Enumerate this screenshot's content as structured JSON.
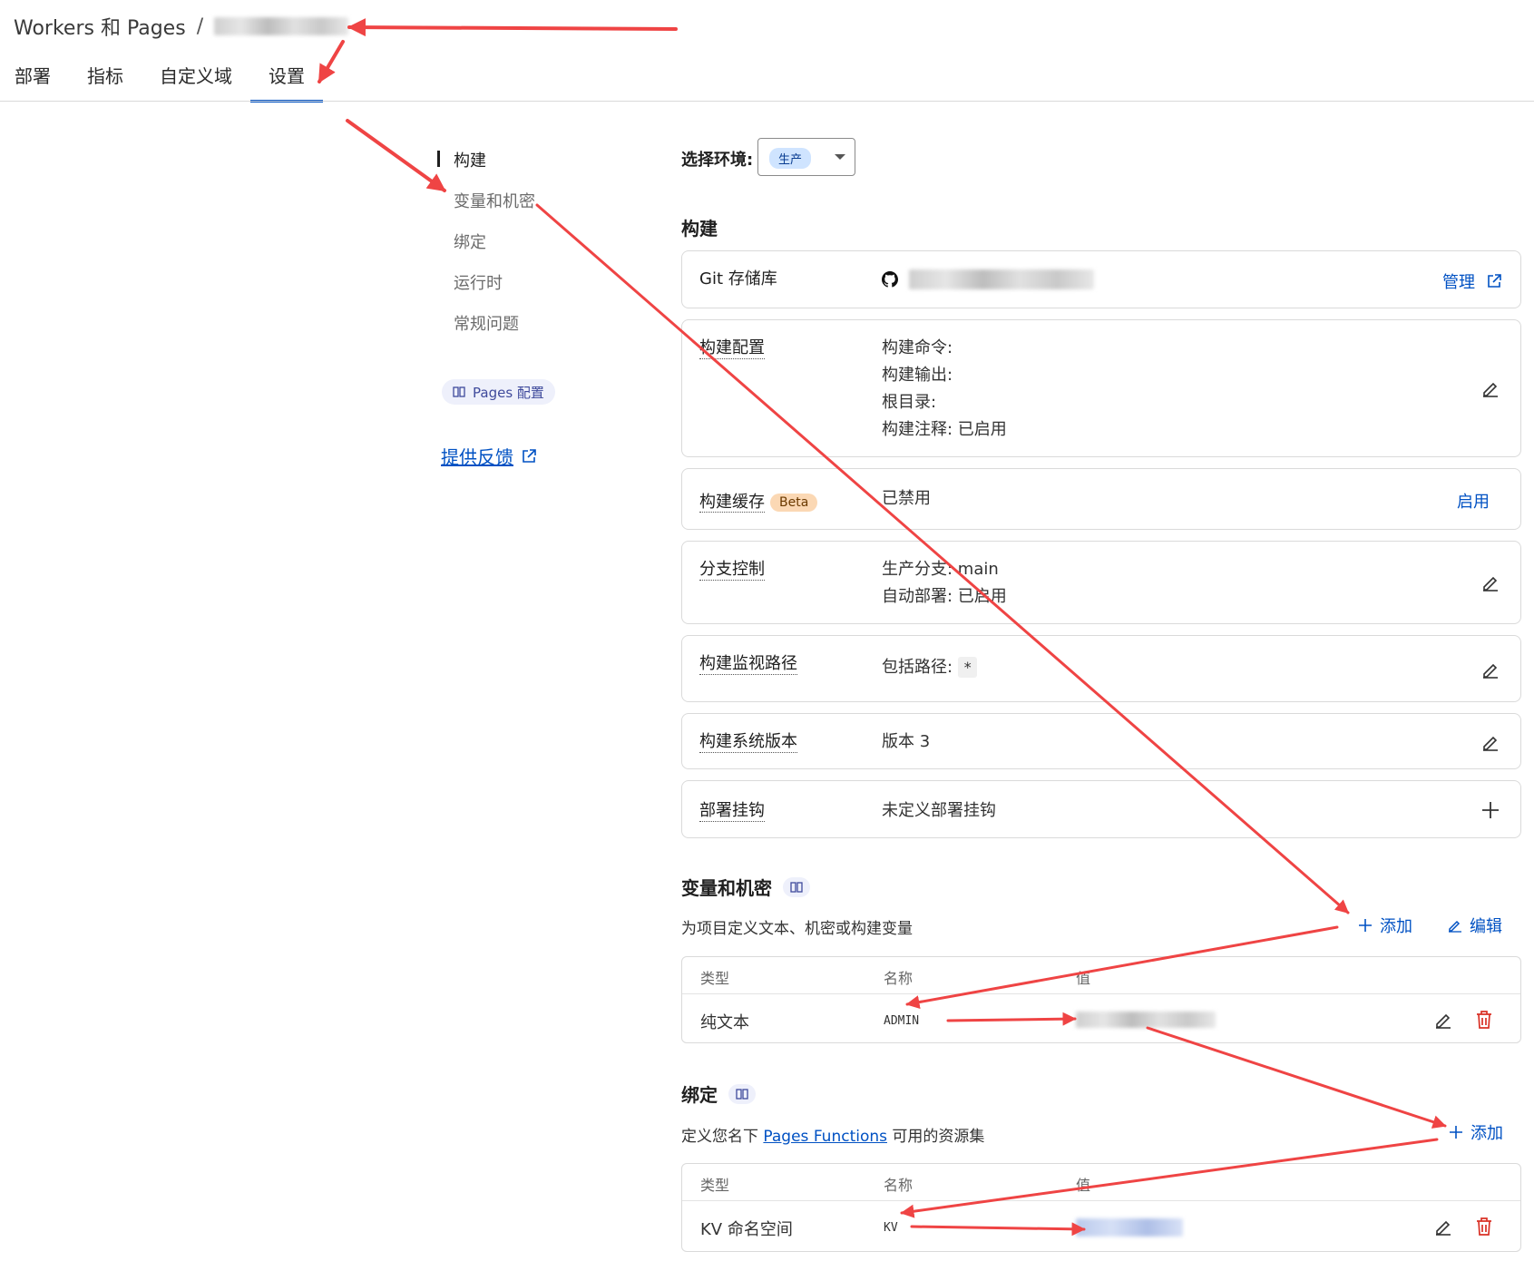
{
  "header": {
    "breadcrumb_root": "Workers 和 Pages",
    "breadcrumb_sep": "/",
    "tabs": [
      "部署",
      "指标",
      "自定义域",
      "设置"
    ],
    "active_tab": "设置"
  },
  "left_nav": {
    "items": [
      "构建",
      "变量和机密",
      "绑定",
      "运行时",
      "常规问题"
    ],
    "active": "构建",
    "pages_config": "Pages 配置",
    "feedback": "提供反馈"
  },
  "env": {
    "label": "选择环境:",
    "value": "生产"
  },
  "build": {
    "title": "构建",
    "git": {
      "label": "Git 存储库",
      "action": "管理"
    },
    "config": {
      "label": "构建配置",
      "lines": [
        "构建命令:",
        "构建输出:",
        "根目录:",
        "构建注释: 已启用"
      ]
    },
    "cache": {
      "label": "构建缓存",
      "badge": "Beta",
      "value": "已禁用",
      "action": "启用"
    },
    "branch": {
      "label": "分支控制",
      "lines": [
        "生产分支: main",
        "自动部署: 已启用"
      ]
    },
    "watch": {
      "label": "构建监视路径",
      "prefix": "包括路径:",
      "code": "*"
    },
    "system": {
      "label": "构建系统版本",
      "value": "版本 3"
    },
    "hooks": {
      "label": "部署挂钩",
      "value": "未定义部署挂钩"
    }
  },
  "variables": {
    "title": "变量和机密",
    "subtitle": "为项目定义文本、机密或构建变量",
    "add": "添加",
    "edit": "编辑",
    "columns": [
      "类型",
      "名称",
      "值"
    ],
    "rows": [
      {
        "type": "纯文本",
        "name": "ADMIN"
      }
    ]
  },
  "bindings": {
    "title": "绑定",
    "subtitle_prefix": "定义您名下",
    "subtitle_link": "Pages Functions",
    "subtitle_suffix": "可用的资源集",
    "add": "添加",
    "columns": [
      "类型",
      "名称",
      "值"
    ],
    "rows": [
      {
        "type": "KV 命名空间",
        "name": "KV"
      }
    ]
  },
  "colors": {
    "accent": "#0051c3",
    "annotation_arrow": "#ef4444",
    "delete": "#d93025"
  }
}
